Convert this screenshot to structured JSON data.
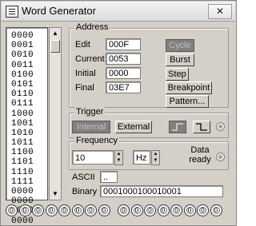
{
  "window": {
    "title": "Word Generator",
    "close_glyph": "✕",
    "icon": "word-generator-app-icon"
  },
  "word_list": [
    "0000",
    "0001",
    "0010",
    "0011",
    "0100",
    "0101",
    "0110",
    "0111",
    "1000",
    "1001",
    "1010",
    "1011",
    "1100",
    "1101",
    "1110",
    "1111",
    "0000",
    "0000",
    "0000",
    "0000"
  ],
  "address": {
    "group_label": "Address",
    "edit_label": "Edit",
    "edit_value": "000F",
    "current_label": "Current",
    "current_value": "0053",
    "initial_label": "Initial",
    "initial_value": "0000",
    "final_label": "Final",
    "final_value": "03E7"
  },
  "controls": {
    "cycle": "Cycle",
    "burst": "Burst",
    "step": "Step",
    "breakpoint": "Breakpoint",
    "pattern": "Pattern..."
  },
  "trigger": {
    "group_label": "Trigger",
    "internal": "Internal",
    "external": "External",
    "rising_edge_icon": "rising-edge-icon",
    "falling_edge_icon": "falling-edge-icon"
  },
  "frequency": {
    "group_label": "Frequency",
    "value": "10",
    "unit": "Hz",
    "data_ready_label": "Data ready"
  },
  "ascii": {
    "label": "ASCII",
    "value": ".."
  },
  "binary": {
    "label": "Binary",
    "value": "0001000100010001"
  },
  "indicators": [
    "0",
    "0",
    "0",
    "0",
    "0",
    "0",
    "0",
    "0",
    "0",
    "0",
    "0",
    "0",
    "0",
    "0",
    "0",
    "0"
  ],
  "colors": {
    "disabled_button": "#808080",
    "window_bg": "#d4d0c8"
  }
}
